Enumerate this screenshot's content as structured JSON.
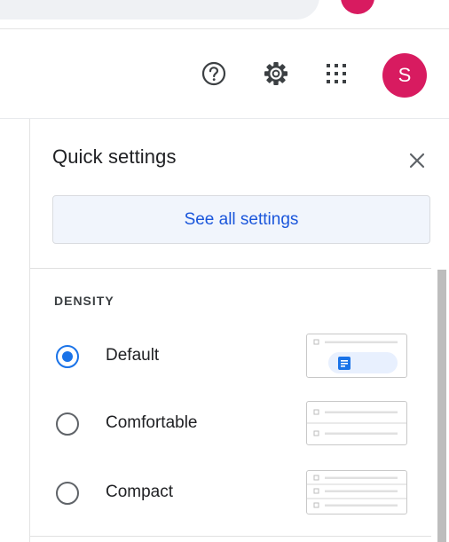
{
  "header": {
    "icons": [
      "help-icon",
      "gear-icon",
      "apps-grid-icon"
    ],
    "avatar_initial": "S",
    "avatar_color": "#d81b60"
  },
  "quick_settings": {
    "title": "Quick settings",
    "close_icon": "close-icon",
    "see_all_label": "See all settings",
    "accent_color": "#1a73e8",
    "density": {
      "heading": "DENSITY",
      "selected": "Default",
      "options": [
        {
          "label": "Default",
          "checked": true
        },
        {
          "label": "Comfortable",
          "checked": false
        },
        {
          "label": "Compact",
          "checked": false
        }
      ]
    }
  }
}
